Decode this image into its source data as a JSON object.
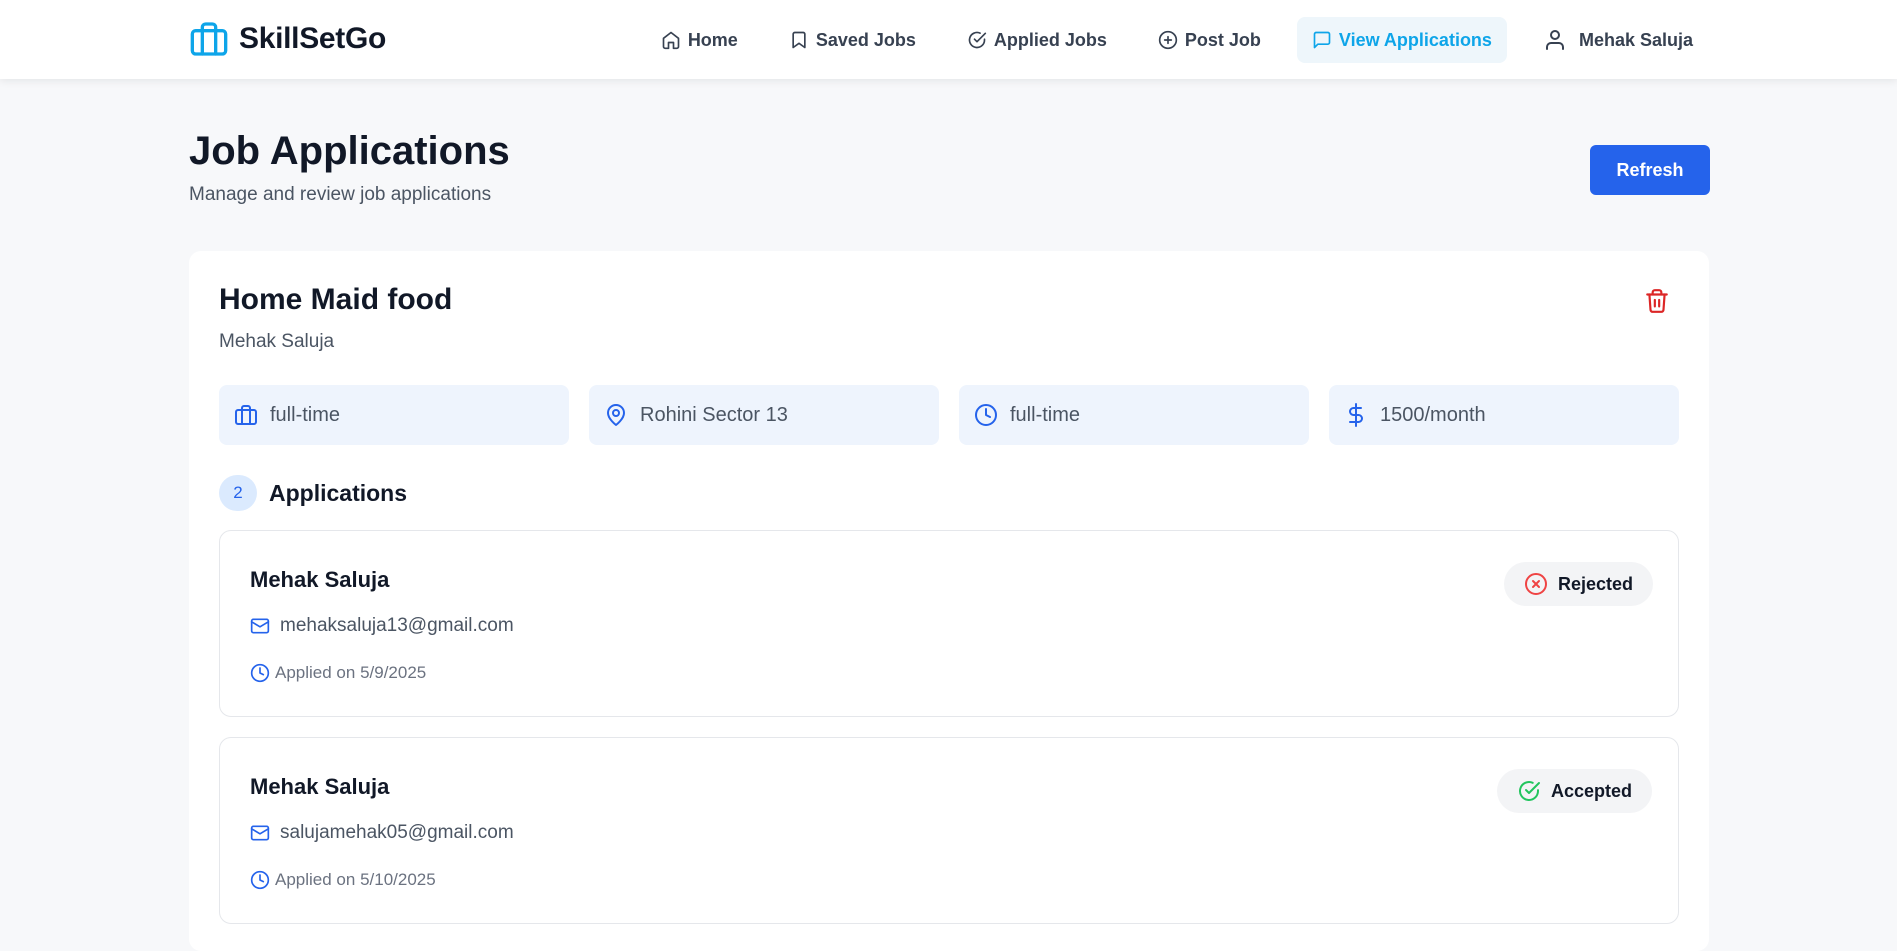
{
  "brand": {
    "name": "SkillSetGo",
    "accent": "#0ea5e9"
  },
  "nav": {
    "items": [
      {
        "label": "Home",
        "icon": "home-icon"
      },
      {
        "label": "Saved Jobs",
        "icon": "bookmark-icon"
      },
      {
        "label": "Applied Jobs",
        "icon": "check-circle-icon"
      },
      {
        "label": "Post Job",
        "icon": "plus-circle-icon"
      },
      {
        "label": "View Applications",
        "icon": "message-square-icon",
        "active": true
      }
    ],
    "profile": {
      "label": "Mehak Saluja",
      "icon": "user-icon"
    }
  },
  "header": {
    "title": "Job Applications",
    "subtitle": "Manage and review job applications",
    "refresh_label": "Refresh"
  },
  "job": {
    "title": "Home Maid food",
    "company": "Mehak Saluja",
    "details": [
      {
        "icon": "briefcase-icon",
        "text": "full-time"
      },
      {
        "icon": "map-pin-icon",
        "text": "Rohini Sector 13"
      },
      {
        "icon": "clock-icon",
        "text": "full-time"
      },
      {
        "icon": "dollar-icon",
        "text": "1500/month"
      }
    ],
    "applications_count": "2",
    "applications_label": "Applications",
    "applications": [
      {
        "name": "Mehak Saluja",
        "email": "mehaksaluja13@gmail.com",
        "applied": "Applied on 5/9/2025",
        "status": "Rejected",
        "status_color": "#ef4444"
      },
      {
        "name": "Mehak Saluja",
        "email": "salujamehak05@gmail.com",
        "applied": "Applied on 5/10/2025",
        "status": "Accepted",
        "status_color": "#22c55e"
      }
    ]
  },
  "colors": {
    "primary_button": "#2563eb",
    "delete": "#dc2626",
    "page_bg": "#f7f8fa"
  }
}
